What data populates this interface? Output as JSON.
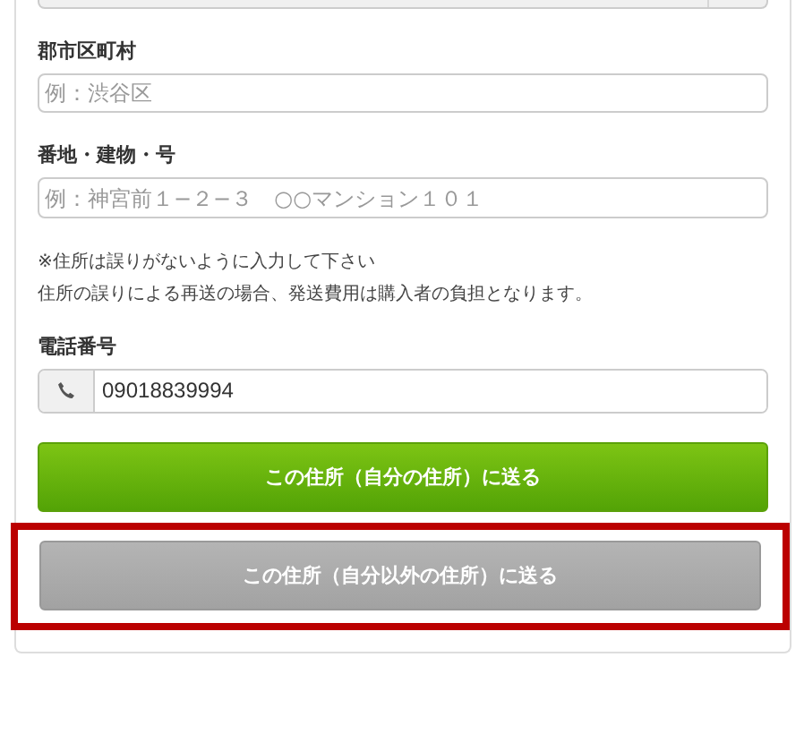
{
  "top_select": {
    "kind": "select"
  },
  "fields": [
    {
      "label": "郡市区町村",
      "placeholder": "例：渋谷区"
    },
    {
      "label": "番地・建物・号",
      "placeholder": "例：神宮前１−２−３　○○マンション１０１"
    }
  ],
  "notes": [
    "※住所は誤りがないように入力して下さい",
    "住所の誤りによる再送の場合、発送費用は購入者の負担となります。"
  ],
  "phone": {
    "label": "電話番号",
    "value": "09018839994"
  },
  "buttons": [
    {
      "label": "この住所（自分の住所）に送る",
      "kind": "primary",
      "highlighted": false
    },
    {
      "label": "この住所（自分以外の住所）に送る",
      "kind": "secondary",
      "highlighted": true
    }
  ]
}
